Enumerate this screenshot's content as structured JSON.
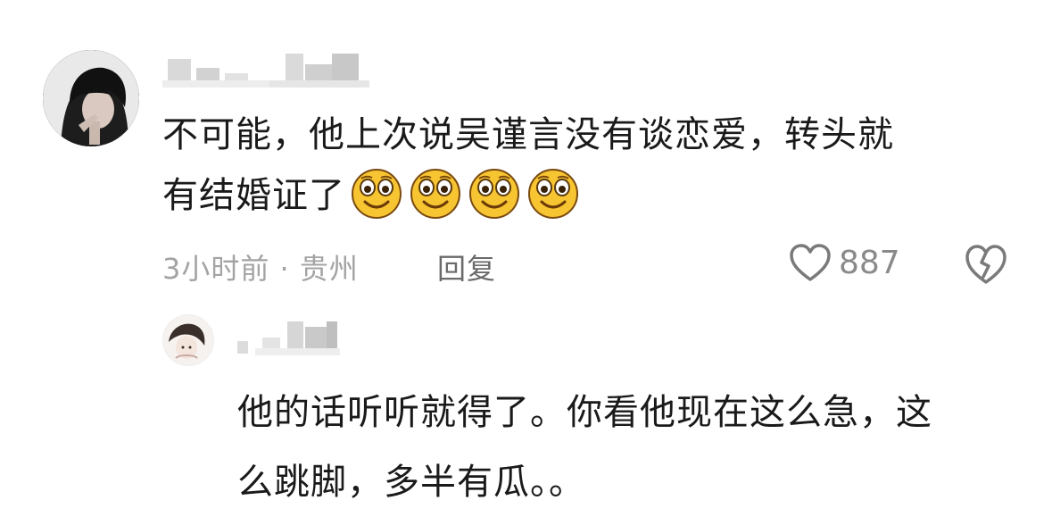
{
  "comment": {
    "text_lines": [
      "不可能，他上次说吴谨言没有谈恋爱，转头就",
      "有结婚证了"
    ],
    "emojis": [
      "smile-emoji",
      "smile-emoji",
      "smile-emoji",
      "smile-emoji"
    ],
    "meta": "3小时前 · 贵州",
    "reply_label": "回复",
    "like_count": "887",
    "like_icon": "heart-outline-icon",
    "dislike_icon": "broken-heart-icon"
  },
  "reply": {
    "text_lines": [
      "他的话听听就得了。你看他现在这么急，这",
      "么跳脚，多半有瓜。。"
    ]
  },
  "colors": {
    "text": "#1a1a1a",
    "meta": "#a3a3a3",
    "icon": "#7a7a7a",
    "emoji_face": "#f7c531"
  }
}
